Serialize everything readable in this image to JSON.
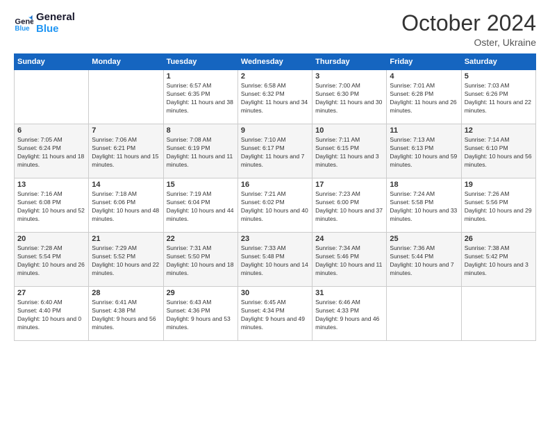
{
  "logo": {
    "line1": "General",
    "line2": "Blue"
  },
  "title": "October 2024",
  "subtitle": "Oster, Ukraine",
  "days_header": [
    "Sunday",
    "Monday",
    "Tuesday",
    "Wednesday",
    "Thursday",
    "Friday",
    "Saturday"
  ],
  "weeks": [
    [
      {
        "day": "",
        "info": ""
      },
      {
        "day": "",
        "info": ""
      },
      {
        "day": "1",
        "info": "Sunrise: 6:57 AM\nSunset: 6:35 PM\nDaylight: 11 hours and 38 minutes."
      },
      {
        "day": "2",
        "info": "Sunrise: 6:58 AM\nSunset: 6:32 PM\nDaylight: 11 hours and 34 minutes."
      },
      {
        "day": "3",
        "info": "Sunrise: 7:00 AM\nSunset: 6:30 PM\nDaylight: 11 hours and 30 minutes."
      },
      {
        "day": "4",
        "info": "Sunrise: 7:01 AM\nSunset: 6:28 PM\nDaylight: 11 hours and 26 minutes."
      },
      {
        "day": "5",
        "info": "Sunrise: 7:03 AM\nSunset: 6:26 PM\nDaylight: 11 hours and 22 minutes."
      }
    ],
    [
      {
        "day": "6",
        "info": "Sunrise: 7:05 AM\nSunset: 6:24 PM\nDaylight: 11 hours and 18 minutes."
      },
      {
        "day": "7",
        "info": "Sunrise: 7:06 AM\nSunset: 6:21 PM\nDaylight: 11 hours and 15 minutes."
      },
      {
        "day": "8",
        "info": "Sunrise: 7:08 AM\nSunset: 6:19 PM\nDaylight: 11 hours and 11 minutes."
      },
      {
        "day": "9",
        "info": "Sunrise: 7:10 AM\nSunset: 6:17 PM\nDaylight: 11 hours and 7 minutes."
      },
      {
        "day": "10",
        "info": "Sunrise: 7:11 AM\nSunset: 6:15 PM\nDaylight: 11 hours and 3 minutes."
      },
      {
        "day": "11",
        "info": "Sunrise: 7:13 AM\nSunset: 6:13 PM\nDaylight: 10 hours and 59 minutes."
      },
      {
        "day": "12",
        "info": "Sunrise: 7:14 AM\nSunset: 6:10 PM\nDaylight: 10 hours and 56 minutes."
      }
    ],
    [
      {
        "day": "13",
        "info": "Sunrise: 7:16 AM\nSunset: 6:08 PM\nDaylight: 10 hours and 52 minutes."
      },
      {
        "day": "14",
        "info": "Sunrise: 7:18 AM\nSunset: 6:06 PM\nDaylight: 10 hours and 48 minutes."
      },
      {
        "day": "15",
        "info": "Sunrise: 7:19 AM\nSunset: 6:04 PM\nDaylight: 10 hours and 44 minutes."
      },
      {
        "day": "16",
        "info": "Sunrise: 7:21 AM\nSunset: 6:02 PM\nDaylight: 10 hours and 40 minutes."
      },
      {
        "day": "17",
        "info": "Sunrise: 7:23 AM\nSunset: 6:00 PM\nDaylight: 10 hours and 37 minutes."
      },
      {
        "day": "18",
        "info": "Sunrise: 7:24 AM\nSunset: 5:58 PM\nDaylight: 10 hours and 33 minutes."
      },
      {
        "day": "19",
        "info": "Sunrise: 7:26 AM\nSunset: 5:56 PM\nDaylight: 10 hours and 29 minutes."
      }
    ],
    [
      {
        "day": "20",
        "info": "Sunrise: 7:28 AM\nSunset: 5:54 PM\nDaylight: 10 hours and 26 minutes."
      },
      {
        "day": "21",
        "info": "Sunrise: 7:29 AM\nSunset: 5:52 PM\nDaylight: 10 hours and 22 minutes."
      },
      {
        "day": "22",
        "info": "Sunrise: 7:31 AM\nSunset: 5:50 PM\nDaylight: 10 hours and 18 minutes."
      },
      {
        "day": "23",
        "info": "Sunrise: 7:33 AM\nSunset: 5:48 PM\nDaylight: 10 hours and 14 minutes."
      },
      {
        "day": "24",
        "info": "Sunrise: 7:34 AM\nSunset: 5:46 PM\nDaylight: 10 hours and 11 minutes."
      },
      {
        "day": "25",
        "info": "Sunrise: 7:36 AM\nSunset: 5:44 PM\nDaylight: 10 hours and 7 minutes."
      },
      {
        "day": "26",
        "info": "Sunrise: 7:38 AM\nSunset: 5:42 PM\nDaylight: 10 hours and 3 minutes."
      }
    ],
    [
      {
        "day": "27",
        "info": "Sunrise: 6:40 AM\nSunset: 4:40 PM\nDaylight: 10 hours and 0 minutes."
      },
      {
        "day": "28",
        "info": "Sunrise: 6:41 AM\nSunset: 4:38 PM\nDaylight: 9 hours and 56 minutes."
      },
      {
        "day": "29",
        "info": "Sunrise: 6:43 AM\nSunset: 4:36 PM\nDaylight: 9 hours and 53 minutes."
      },
      {
        "day": "30",
        "info": "Sunrise: 6:45 AM\nSunset: 4:34 PM\nDaylight: 9 hours and 49 minutes."
      },
      {
        "day": "31",
        "info": "Sunrise: 6:46 AM\nSunset: 4:33 PM\nDaylight: 9 hours and 46 minutes."
      },
      {
        "day": "",
        "info": ""
      },
      {
        "day": "",
        "info": ""
      }
    ]
  ]
}
